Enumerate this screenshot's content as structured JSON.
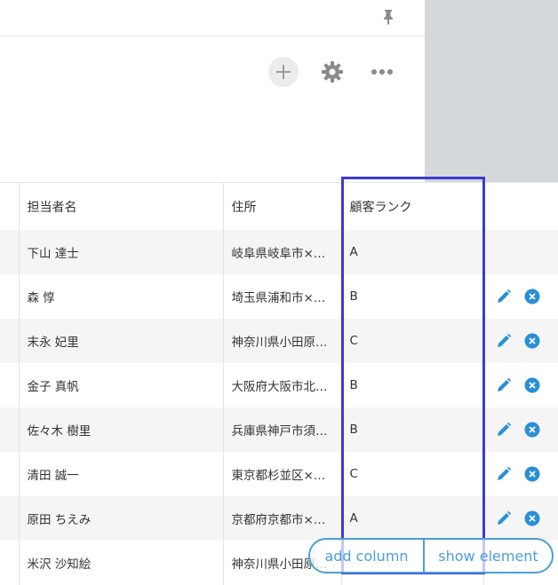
{
  "toolbar": {
    "pin_icon": "pin-icon",
    "add_icon": "plus-icon",
    "settings_icon": "gear-icon",
    "more_icon": "more-horizontal-icon"
  },
  "table": {
    "columns": [
      "",
      "担当者名",
      "住所",
      "顧客ランク",
      ""
    ],
    "rows": [
      {
        "name": "下山 達士",
        "address": "岐阜県岐阜市×…",
        "rank": "A",
        "actions": false
      },
      {
        "name": "森 惇",
        "address": "埼玉県浦和市×…",
        "rank": "B",
        "actions": true
      },
      {
        "name": "末永 妃里",
        "address": "神奈川県小田原…",
        "rank": "C",
        "actions": true
      },
      {
        "name": "金子 真帆",
        "address": "大阪府大阪市北…",
        "rank": "B",
        "actions": true
      },
      {
        "name": "佐々木 樹里",
        "address": "兵庫県神戸市須…",
        "rank": "B",
        "actions": true
      },
      {
        "name": "清田 誠一",
        "address": "東京都杉並区×…",
        "rank": "C",
        "actions": true
      },
      {
        "name": "原田 ちえみ",
        "address": "京都府京都市×…",
        "rank": "A",
        "actions": true
      },
      {
        "name": "米沢 沙知絵",
        "address": "神奈川県小田原…",
        "rank": "",
        "actions": false
      }
    ]
  },
  "overlay": {
    "add_column_label": "add column",
    "show_element_label": "show element"
  },
  "colors": {
    "accent": "#2a8fd6",
    "highlight": "#3b3bd6",
    "pill": "#4a9fd8"
  }
}
